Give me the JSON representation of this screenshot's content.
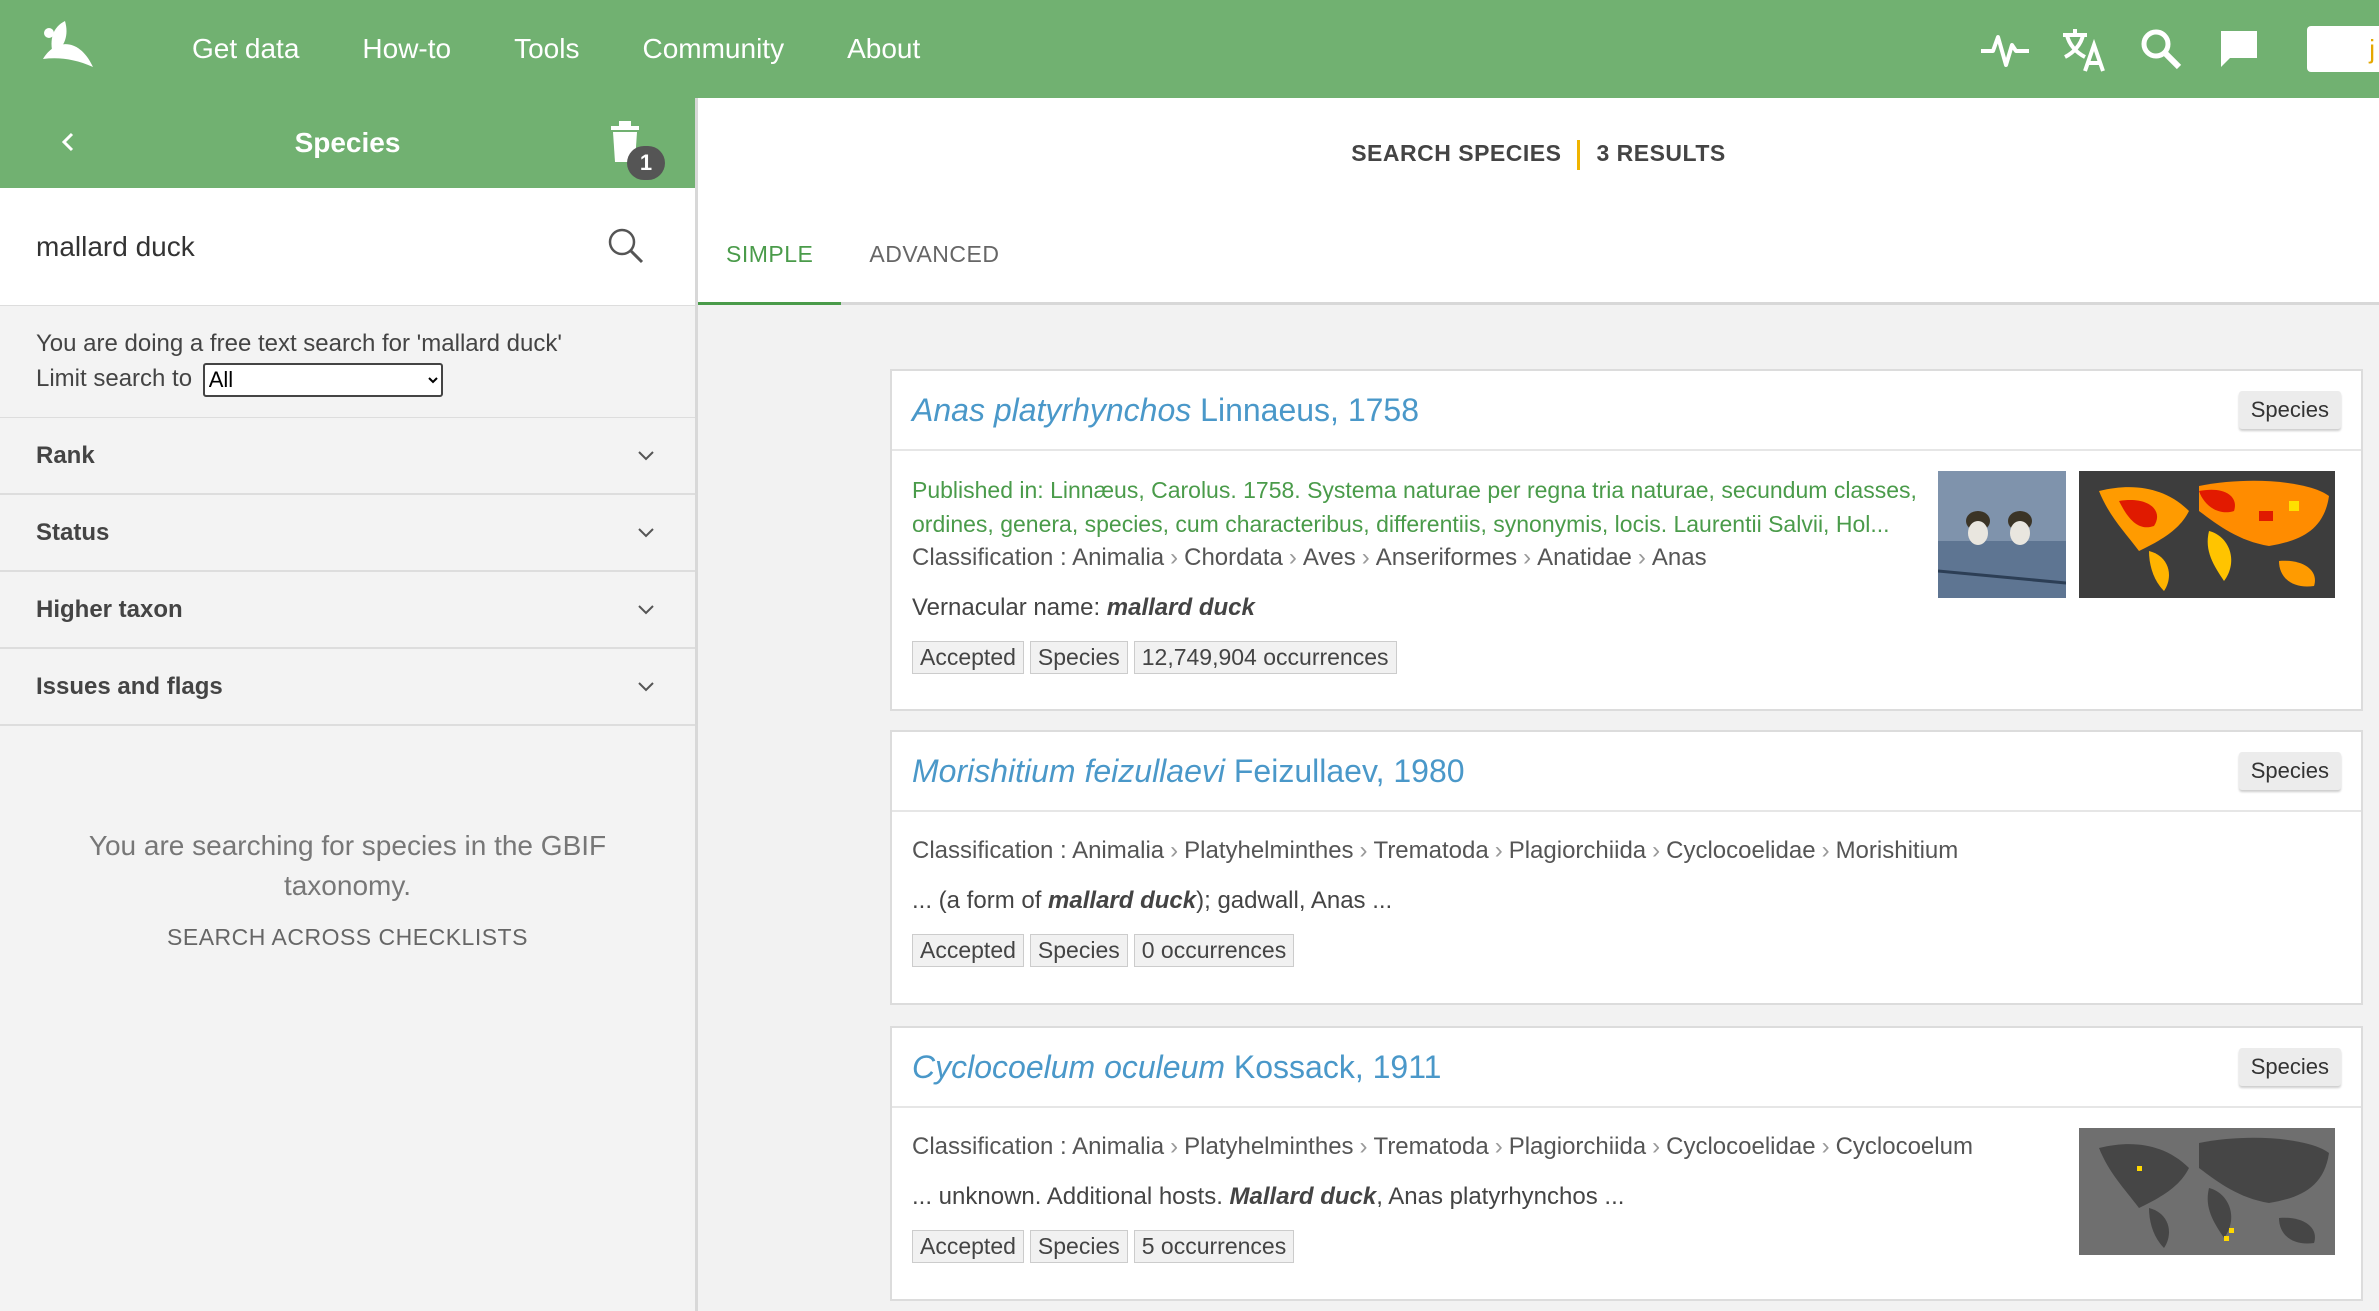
{
  "topnav": {
    "items": [
      "Get data",
      "How-to",
      "Tools",
      "Community",
      "About"
    ],
    "user_initial": "j"
  },
  "sidebar": {
    "title": "Species",
    "badge_count": "1",
    "search_value": "mallard duck",
    "freetext_msg": "You are doing a free text search for 'mallard duck'",
    "limit_label": "Limit search to",
    "limit_value": "All",
    "facets": [
      "Rank",
      "Status",
      "Higher taxon",
      "Issues and flags"
    ],
    "info_text": "You are searching for species in the GBIF taxonomy.",
    "link_text": "SEARCH ACROSS CHECKLISTS"
  },
  "main": {
    "header_left": "SEARCH SPECIES",
    "header_right": "3 RESULTS",
    "tabs": [
      "SIMPLE",
      "ADVANCED"
    ],
    "results": [
      {
        "sci_name": "Anas platyrhynchos",
        "author": "Linnaeus, 1758",
        "rank": "Species",
        "published": "Published in: Linnæus, Carolus. 1758. Systema naturae per regna tria naturae, secundum classes, ordines, genera, species, cum characteribus, differentiis, synonymis, locis. Laurentii Salvii, Hol...",
        "classification_label": "Classification :",
        "classification": [
          "Animalia",
          "Chordata",
          "Aves",
          "Anseriformes",
          "Anatidae",
          "Anas"
        ],
        "snippet_pre": "Vernacular name:",
        "snippet_bold": "mallard duck",
        "snippet_post": "",
        "tags": [
          "Accepted",
          "Species",
          "12,749,904 occurrences"
        ]
      },
      {
        "sci_name": "Morishitium feizullaevi",
        "author": "Feizullaev, 1980",
        "rank": "Species",
        "classification_label": "Classification :",
        "classification": [
          "Animalia",
          "Platyhelminthes",
          "Trematoda",
          "Plagiorchiida",
          "Cyclocoelidae",
          "Morishitium"
        ],
        "snippet_pre": "... (a form of",
        "snippet_bold": "mallard duck",
        "snippet_post": "); gadwall, Anas ...",
        "tags": [
          "Accepted",
          "Species",
          "0 occurrences"
        ]
      },
      {
        "sci_name": "Cyclocoelum oculeum",
        "author": "Kossack, 1911",
        "rank": "Species",
        "classification_label": "Classification :",
        "classification": [
          "Animalia",
          "Platyhelminthes",
          "Trematoda",
          "Plagiorchiida",
          "Cyclocoelidae",
          "Cyclocoelum"
        ],
        "snippet_pre": "... unknown. Additional hosts.",
        "snippet_bold": "Mallard duck",
        "snippet_post": ", Anas platyrhynchos ...",
        "tags": [
          "Accepted",
          "Species",
          "5 occurrences"
        ]
      }
    ]
  },
  "colors": {
    "brand_green": "#71b171",
    "link_blue": "#4a98c9",
    "text_green": "#4a9b4a",
    "accent_yellow": "#f0b400"
  }
}
